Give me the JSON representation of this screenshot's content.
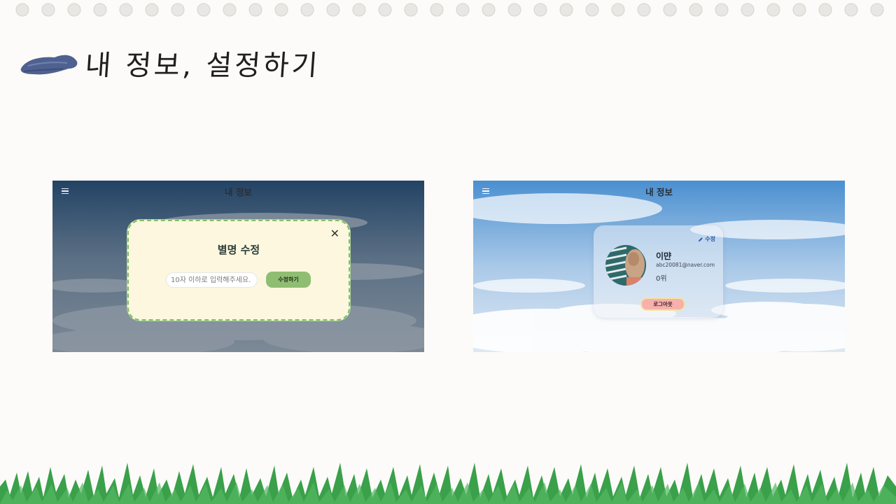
{
  "slide": {
    "title": "내 정보, 설정하기"
  },
  "left_screen": {
    "app_title": "내 정보",
    "modal": {
      "close_glyph": "✕",
      "title": "별명 수정",
      "input_placeholder": "10자 이하로 입력해주세요.",
      "input_value": "",
      "submit_label": "수정하기"
    }
  },
  "right_screen": {
    "app_title": "내 정보",
    "card": {
      "edit_label": "수정",
      "user_name": "이먄",
      "user_email": "abc20081@naver.com",
      "user_rank": "0위",
      "logout_label": "로그아웃"
    }
  },
  "colors": {
    "background": "#fcfbf9",
    "modal_bg": "#fdf7df",
    "modal_border": "#7fbf67",
    "submit_button": "#8fbe72",
    "logout_button": "#f7b0ab",
    "edit_link": "#2d5da6",
    "grass": "#3aa04a"
  },
  "icons": {
    "menu": "hamburger-icon",
    "close": "close-icon",
    "edit": "pencil-icon"
  }
}
